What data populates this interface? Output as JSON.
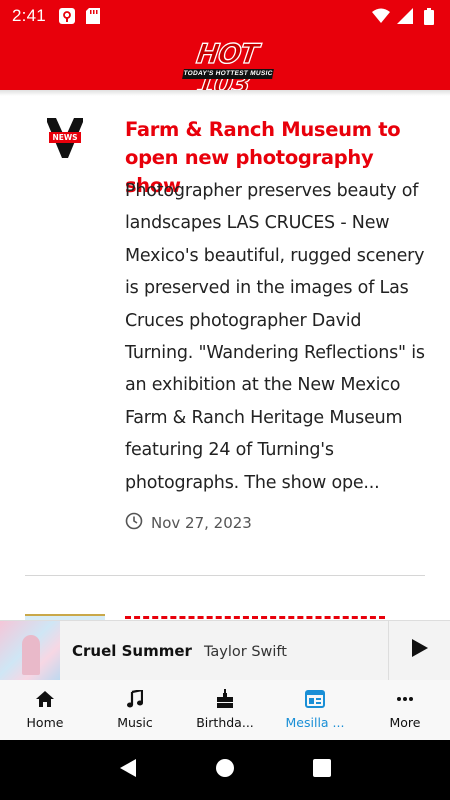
{
  "status_bar": {
    "time": "2:41",
    "icons_left": [
      "podcast-icon",
      "sd-card-icon"
    ],
    "icons_right": [
      "wifi-icon",
      "signal-icon",
      "battery-icon"
    ]
  },
  "app_bar": {
    "logo_text": "HOT 103",
    "logo_tagline": "TODAY'S HOTTEST MUSIC",
    "background": "#e8000b"
  },
  "article": {
    "thumb_label": "NEWS",
    "title": "Farm & Ranch Museum to open new photography show",
    "body": "Photographer preserves beauty of landscapes LAS CRUCES - New Mexico's beautiful, rugged scenery is preserved in the images of Las Cruces photographer David Turning. \"Wandering Reflections\" is an exhibition at the New Mexico Farm & Ranch Heritage Museum featuring 24 of Turning's photographs. The show ope...",
    "date": "Nov 27, 2023",
    "title_color": "#e8000b"
  },
  "mini_player": {
    "track_title": "Cruel Summer",
    "artist": "Taylor Swift"
  },
  "bottom_nav": {
    "items": [
      {
        "label": "Home",
        "icon": "home-icon"
      },
      {
        "label": "Music",
        "icon": "music-note-icon"
      },
      {
        "label": "Birthda...",
        "icon": "cake-icon"
      },
      {
        "label": "Mesilla ...",
        "icon": "news-icon"
      },
      {
        "label": "More",
        "icon": "more-icon"
      }
    ],
    "active_index": 3,
    "active_color": "#1a8fd6"
  }
}
